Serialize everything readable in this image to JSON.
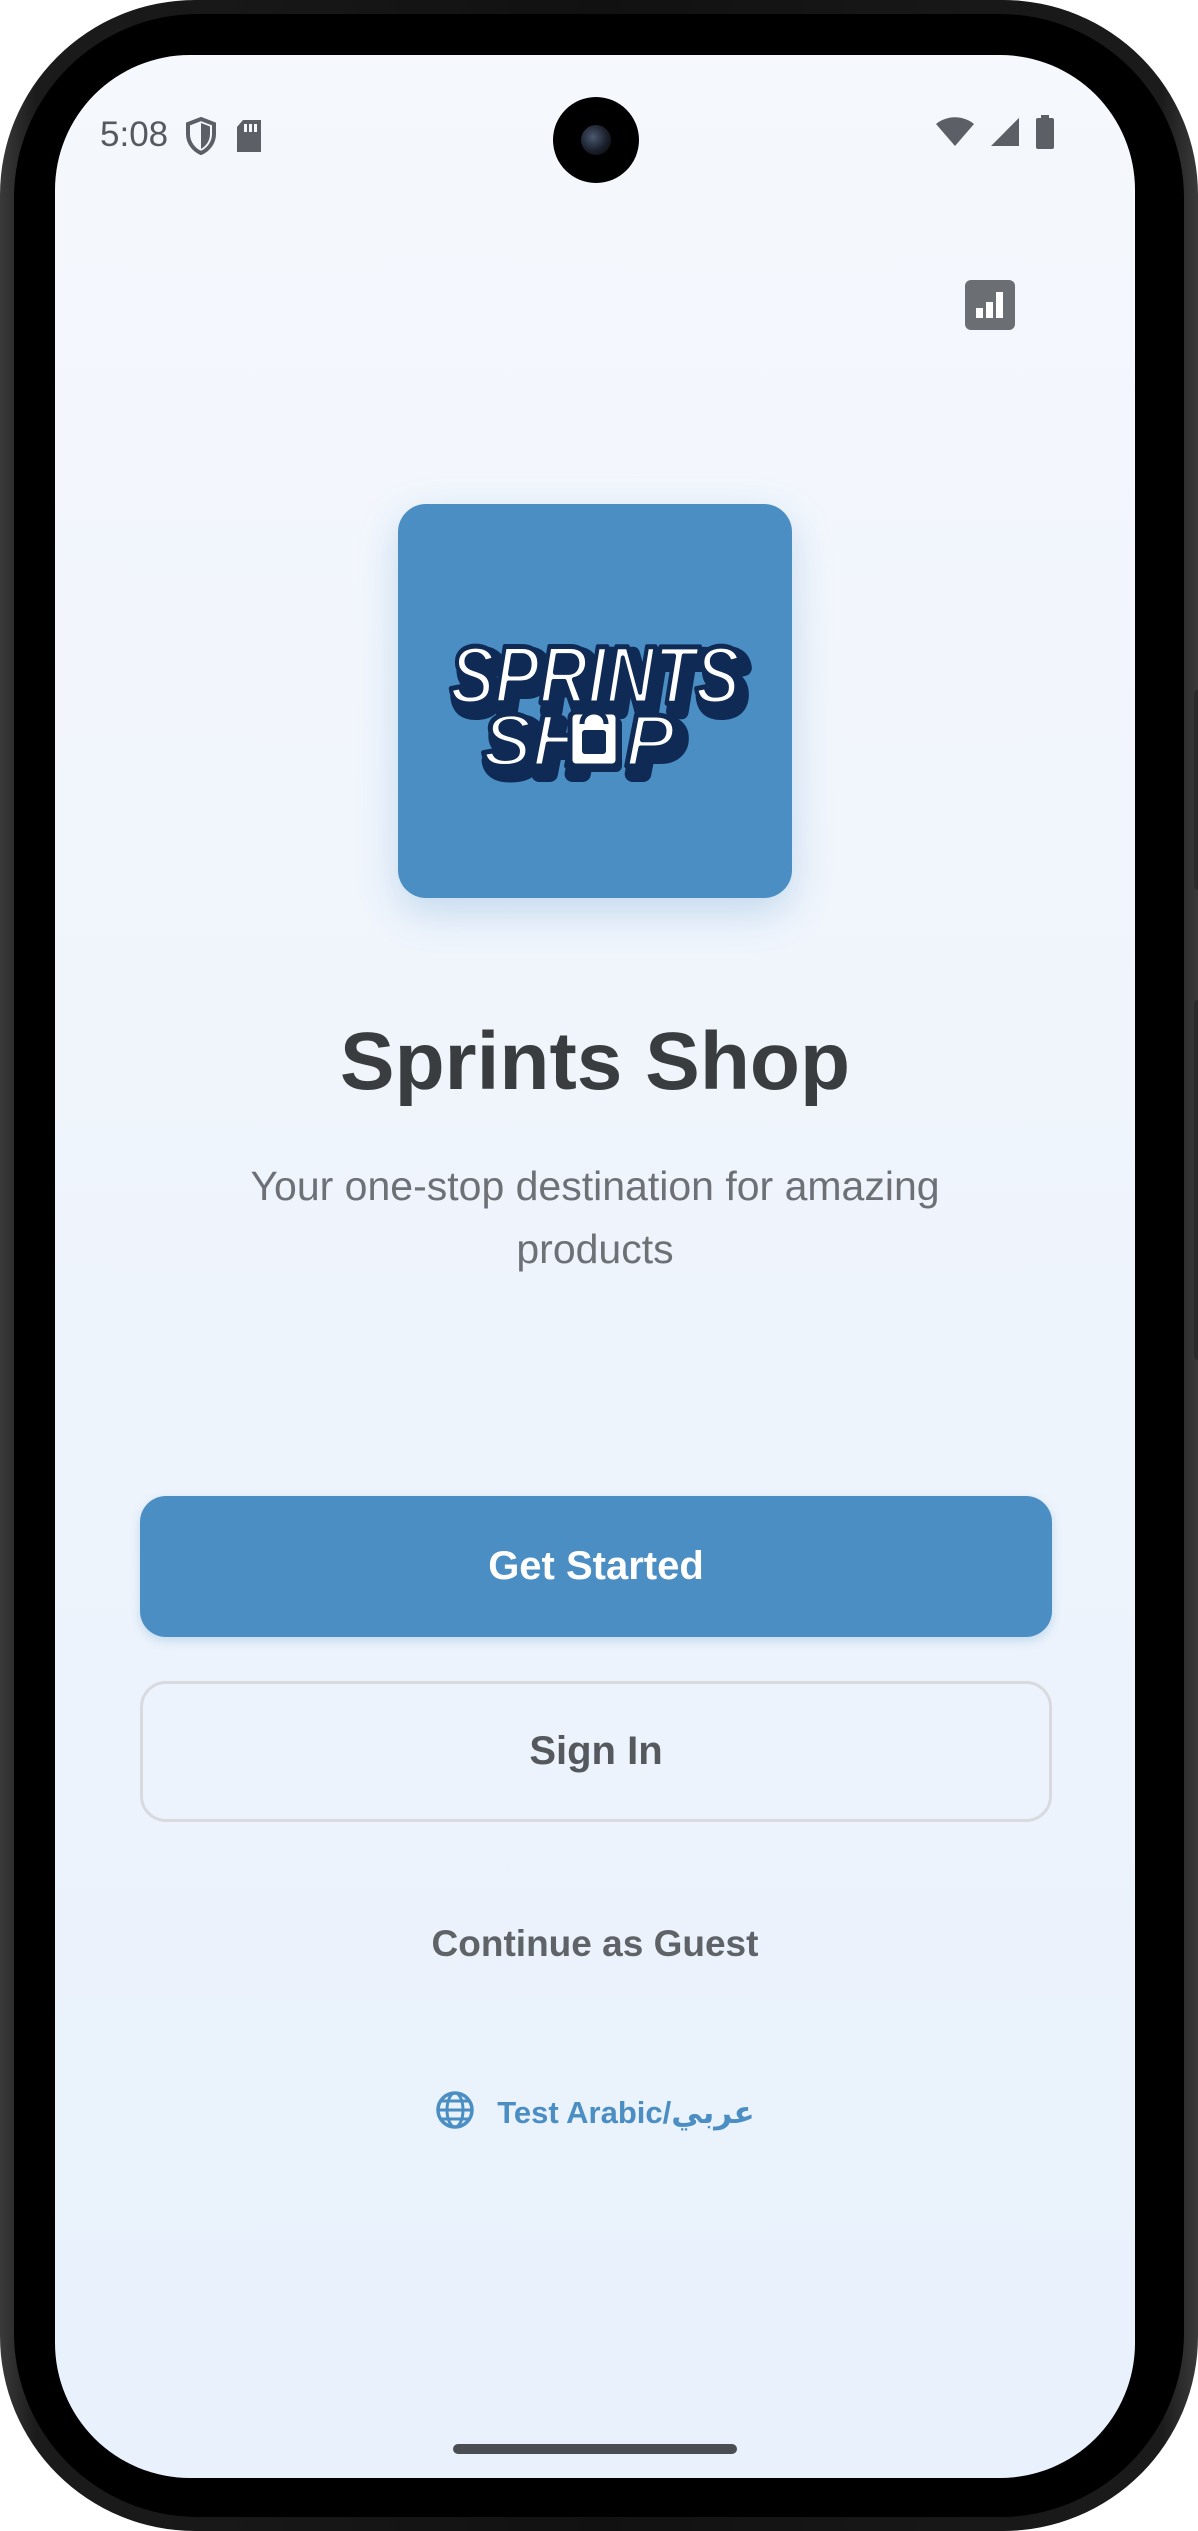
{
  "status_bar": {
    "time": "5:08",
    "left_icons": [
      "shield-icon",
      "sd-card-icon"
    ],
    "right_icons": [
      "wifi-icon",
      "cellular-signal-icon",
      "battery-icon"
    ]
  },
  "top_action": {
    "icon": "chart-icon"
  },
  "logo": {
    "line1": "SPRINTS",
    "line2_a": "SH",
    "line2_b": "P",
    "icon": "shopping-bag-icon"
  },
  "app": {
    "title": "Sprints Shop",
    "tagline": "Your one-stop destination for amazing products"
  },
  "actions": {
    "primary_label": "Get Started",
    "secondary_label": "Sign In",
    "guest_label": "Continue as Guest"
  },
  "language": {
    "icon": "globe-icon",
    "label": "Test Arabic/عربي"
  },
  "colors": {
    "brand": "#4b8ec4",
    "title_text": "#3a3d40",
    "body_text": "#6d7176",
    "logo_navy": "#0f2a55"
  }
}
